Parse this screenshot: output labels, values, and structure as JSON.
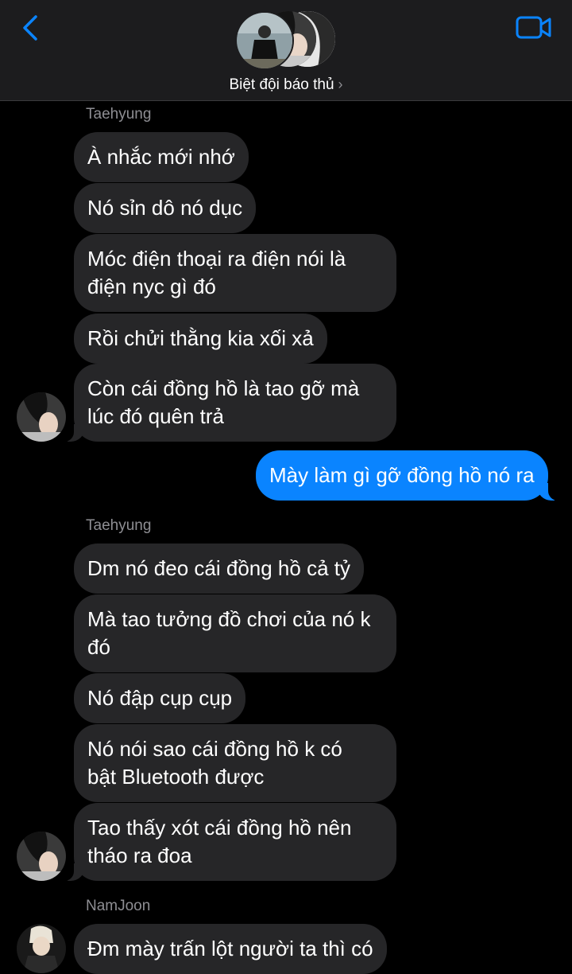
{
  "header": {
    "title": "Biệt đội báo thủ",
    "chevron": "›",
    "back_icon": "chevron-left-icon",
    "video_icon": "video-camera-icon",
    "accent": "#0a84ff"
  },
  "messages": [
    {
      "sender": "Taehyung"
    },
    {
      "lines": [
        "À nhắc mới nhớ"
      ]
    },
    {
      "lines": [
        "Nó sỉn dô nó dục"
      ]
    },
    {
      "lines": [
        "Móc điện thoại ra điện nói là",
        "điện nyc gì đó"
      ]
    },
    {
      "lines": [
        "Rồi chửi thằng kia xối xả"
      ]
    },
    {
      "lines": [
        "Còn cái đồng hồ là tao gỡ mà",
        "lúc đó quên trả"
      ]
    },
    {
      "lines": [
        "Mày làm gì gỡ đồng hồ nó ra"
      ],
      "outgoing": true
    },
    {
      "sender": "Taehyung"
    },
    {
      "lines": [
        "Dm nó đeo cái đồng hồ cả tỷ"
      ]
    },
    {
      "lines": [
        "Mà tao tưởng đồ chơi của nó k",
        "đó"
      ]
    },
    {
      "lines": [
        "Nó đập cụp cụp"
      ]
    },
    {
      "lines": [
        "Nó nói sao cái đồng hồ k  có",
        "bật Bluetooth được"
      ]
    },
    {
      "lines": [
        "Tao thấy xót cái đồng hồ nên",
        "tháo ra đoa"
      ]
    },
    {
      "sender": "NamJoon"
    },
    {
      "lines": [
        "Đm mày trấn lột người ta thì có"
      ]
    }
  ]
}
